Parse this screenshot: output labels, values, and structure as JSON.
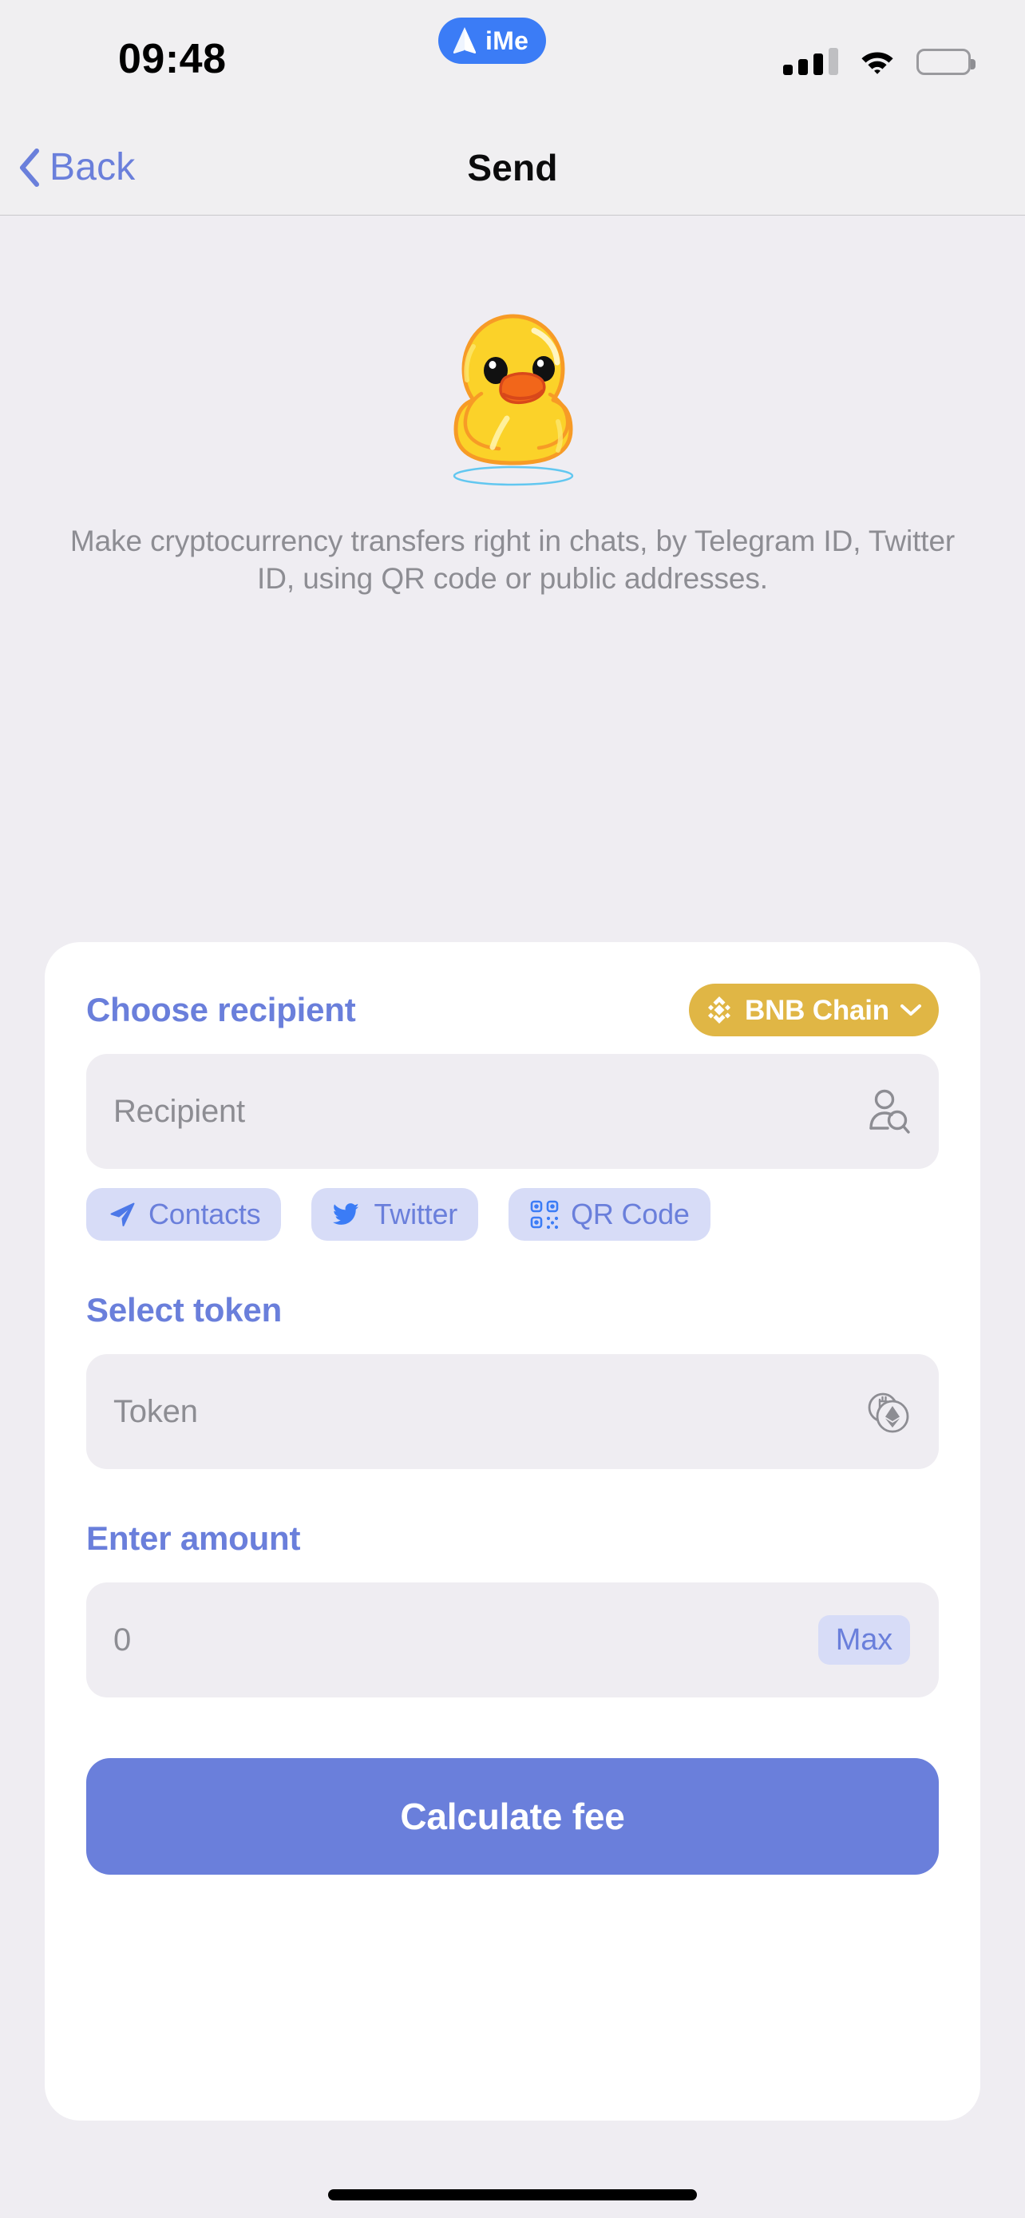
{
  "status_bar": {
    "time": "09:48",
    "app_pill_label": "iMe",
    "app_pill_icon": "ime-logo-icon",
    "signal_icon": "cellular-signal-icon",
    "wifi_icon": "wifi-icon",
    "battery_icon": "battery-icon"
  },
  "nav": {
    "back_label": "Back",
    "back_icon": "chevron-left-icon",
    "title": "Send"
  },
  "hero": {
    "illustration": "rubber-duck-sticker",
    "description": "Make cryptocurrency transfers right in chats, by Telegram ID, Twitter ID, using QR code or public addresses."
  },
  "recipient": {
    "section_title": "Choose recipient",
    "chain_chip": {
      "label": "BNB Chain",
      "icon": "bnb-chain-icon",
      "chevron_icon": "chevron-down-icon",
      "color": "#E0B645"
    },
    "input_placeholder": "Recipient",
    "input_value": "",
    "input_icon": "person-search-icon",
    "chips": [
      {
        "label": "Contacts",
        "icon": "paper-plane-icon"
      },
      {
        "label": "Twitter",
        "icon": "twitter-bird-icon"
      },
      {
        "label": "QR Code",
        "icon": "qr-code-icon"
      }
    ]
  },
  "token": {
    "section_title": "Select token",
    "input_placeholder": "Token",
    "input_value": "",
    "input_icon": "crypto-coins-icon"
  },
  "amount": {
    "section_title": "Enter amount",
    "input_placeholder": "0",
    "input_value": "0",
    "max_label": "Max"
  },
  "cta": {
    "label": "Calculate fee",
    "color": "#6A7FDB"
  },
  "colors": {
    "accent": "#6A7FDB",
    "chip_bg": "#D7DCF7",
    "page_bg": "#EFEDF2",
    "card_bg": "#FFFFFF",
    "field_bg": "#EFEDF2",
    "muted_text": "#8D8D93",
    "bnb_gold": "#E0B645"
  }
}
